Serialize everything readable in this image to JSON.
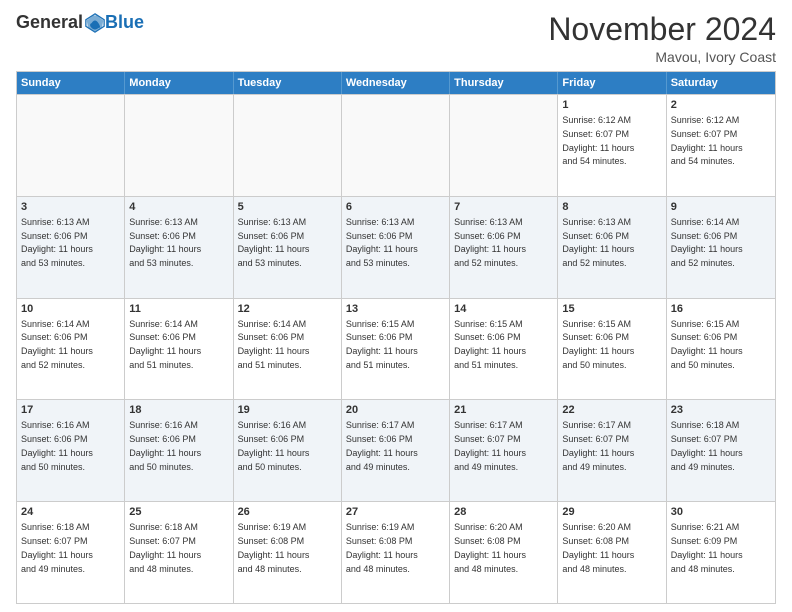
{
  "logo": {
    "general": "General",
    "blue": "Blue"
  },
  "header": {
    "month": "November 2024",
    "location": "Mavou, Ivory Coast"
  },
  "days": [
    "Sunday",
    "Monday",
    "Tuesday",
    "Wednesday",
    "Thursday",
    "Friday",
    "Saturday"
  ],
  "rows": [
    [
      {
        "num": "",
        "text": ""
      },
      {
        "num": "",
        "text": ""
      },
      {
        "num": "",
        "text": ""
      },
      {
        "num": "",
        "text": ""
      },
      {
        "num": "",
        "text": ""
      },
      {
        "num": "1",
        "text": "Sunrise: 6:12 AM\nSunset: 6:07 PM\nDaylight: 11 hours\nand 54 minutes."
      },
      {
        "num": "2",
        "text": "Sunrise: 6:12 AM\nSunset: 6:07 PM\nDaylight: 11 hours\nand 54 minutes."
      }
    ],
    [
      {
        "num": "3",
        "text": "Sunrise: 6:13 AM\nSunset: 6:06 PM\nDaylight: 11 hours\nand 53 minutes."
      },
      {
        "num": "4",
        "text": "Sunrise: 6:13 AM\nSunset: 6:06 PM\nDaylight: 11 hours\nand 53 minutes."
      },
      {
        "num": "5",
        "text": "Sunrise: 6:13 AM\nSunset: 6:06 PM\nDaylight: 11 hours\nand 53 minutes."
      },
      {
        "num": "6",
        "text": "Sunrise: 6:13 AM\nSunset: 6:06 PM\nDaylight: 11 hours\nand 53 minutes."
      },
      {
        "num": "7",
        "text": "Sunrise: 6:13 AM\nSunset: 6:06 PM\nDaylight: 11 hours\nand 52 minutes."
      },
      {
        "num": "8",
        "text": "Sunrise: 6:13 AM\nSunset: 6:06 PM\nDaylight: 11 hours\nand 52 minutes."
      },
      {
        "num": "9",
        "text": "Sunrise: 6:14 AM\nSunset: 6:06 PM\nDaylight: 11 hours\nand 52 minutes."
      }
    ],
    [
      {
        "num": "10",
        "text": "Sunrise: 6:14 AM\nSunset: 6:06 PM\nDaylight: 11 hours\nand 52 minutes."
      },
      {
        "num": "11",
        "text": "Sunrise: 6:14 AM\nSunset: 6:06 PM\nDaylight: 11 hours\nand 51 minutes."
      },
      {
        "num": "12",
        "text": "Sunrise: 6:14 AM\nSunset: 6:06 PM\nDaylight: 11 hours\nand 51 minutes."
      },
      {
        "num": "13",
        "text": "Sunrise: 6:15 AM\nSunset: 6:06 PM\nDaylight: 11 hours\nand 51 minutes."
      },
      {
        "num": "14",
        "text": "Sunrise: 6:15 AM\nSunset: 6:06 PM\nDaylight: 11 hours\nand 51 minutes."
      },
      {
        "num": "15",
        "text": "Sunrise: 6:15 AM\nSunset: 6:06 PM\nDaylight: 11 hours\nand 50 minutes."
      },
      {
        "num": "16",
        "text": "Sunrise: 6:15 AM\nSunset: 6:06 PM\nDaylight: 11 hours\nand 50 minutes."
      }
    ],
    [
      {
        "num": "17",
        "text": "Sunrise: 6:16 AM\nSunset: 6:06 PM\nDaylight: 11 hours\nand 50 minutes."
      },
      {
        "num": "18",
        "text": "Sunrise: 6:16 AM\nSunset: 6:06 PM\nDaylight: 11 hours\nand 50 minutes."
      },
      {
        "num": "19",
        "text": "Sunrise: 6:16 AM\nSunset: 6:06 PM\nDaylight: 11 hours\nand 50 minutes."
      },
      {
        "num": "20",
        "text": "Sunrise: 6:17 AM\nSunset: 6:06 PM\nDaylight: 11 hours\nand 49 minutes."
      },
      {
        "num": "21",
        "text": "Sunrise: 6:17 AM\nSunset: 6:07 PM\nDaylight: 11 hours\nand 49 minutes."
      },
      {
        "num": "22",
        "text": "Sunrise: 6:17 AM\nSunset: 6:07 PM\nDaylight: 11 hours\nand 49 minutes."
      },
      {
        "num": "23",
        "text": "Sunrise: 6:18 AM\nSunset: 6:07 PM\nDaylight: 11 hours\nand 49 minutes."
      }
    ],
    [
      {
        "num": "24",
        "text": "Sunrise: 6:18 AM\nSunset: 6:07 PM\nDaylight: 11 hours\nand 49 minutes."
      },
      {
        "num": "25",
        "text": "Sunrise: 6:18 AM\nSunset: 6:07 PM\nDaylight: 11 hours\nand 48 minutes."
      },
      {
        "num": "26",
        "text": "Sunrise: 6:19 AM\nSunset: 6:08 PM\nDaylight: 11 hours\nand 48 minutes."
      },
      {
        "num": "27",
        "text": "Sunrise: 6:19 AM\nSunset: 6:08 PM\nDaylight: 11 hours\nand 48 minutes."
      },
      {
        "num": "28",
        "text": "Sunrise: 6:20 AM\nSunset: 6:08 PM\nDaylight: 11 hours\nand 48 minutes."
      },
      {
        "num": "29",
        "text": "Sunrise: 6:20 AM\nSunset: 6:08 PM\nDaylight: 11 hours\nand 48 minutes."
      },
      {
        "num": "30",
        "text": "Sunrise: 6:21 AM\nSunset: 6:09 PM\nDaylight: 11 hours\nand 48 minutes."
      }
    ]
  ]
}
